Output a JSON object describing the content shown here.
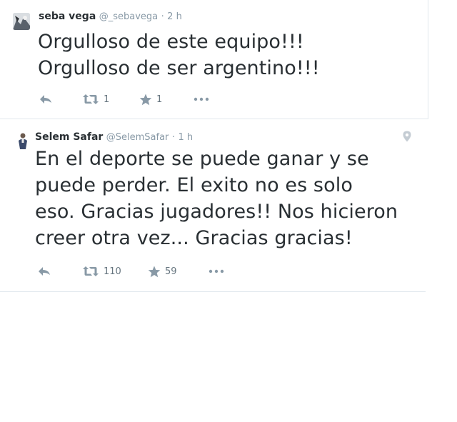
{
  "tweets": [
    {
      "fullname": "seba vega",
      "username": "@_sebavega",
      "separator": "·",
      "time": "2 h",
      "text_lines": [
        "Orgulloso de este equipo!!!",
        "Orgulloso de ser argentino!!!"
      ],
      "retweets": "1",
      "favorites": "1"
    },
    {
      "fullname": "Selem Safar",
      "username": "@SelemSafar",
      "separator": "·",
      "time": "1 h",
      "text_lines": [
        "En el deporte se puede ganar y se",
        "puede perder. El exito no es solo",
        "eso. Gracias jugadores!! Nos hicieron",
        "creer otra vez... Gracias gracias!"
      ],
      "retweets": "110",
      "favorites": "59"
    }
  ],
  "icons": [
    "reply-icon",
    "retweet-icon",
    "favorite-star-icon",
    "more-icon",
    "location-pin-icon"
  ],
  "colors": {
    "icon_gray": "#8899a6",
    "text": "#292f33",
    "border": "#e1e8ed"
  }
}
